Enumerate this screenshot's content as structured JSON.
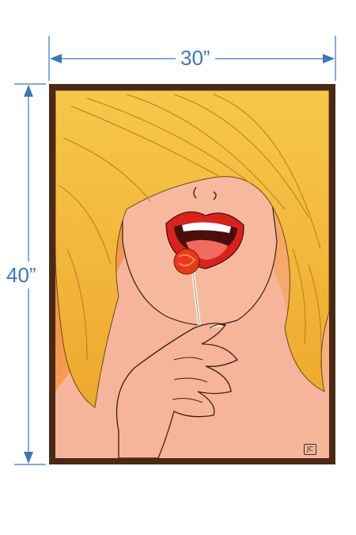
{
  "dimensions": {
    "width_label": "30”",
    "height_label": "40”"
  },
  "colors": {
    "dimension_accent": "#3d77b4",
    "frame": "#4a2a16",
    "background_orange": "#f39a4a",
    "hair": "#f2bb3c",
    "skin": "#f6b49a",
    "lips": "#d8221c",
    "lollipop": "#e7391e"
  },
  "artwork": {
    "signature": "JC"
  }
}
